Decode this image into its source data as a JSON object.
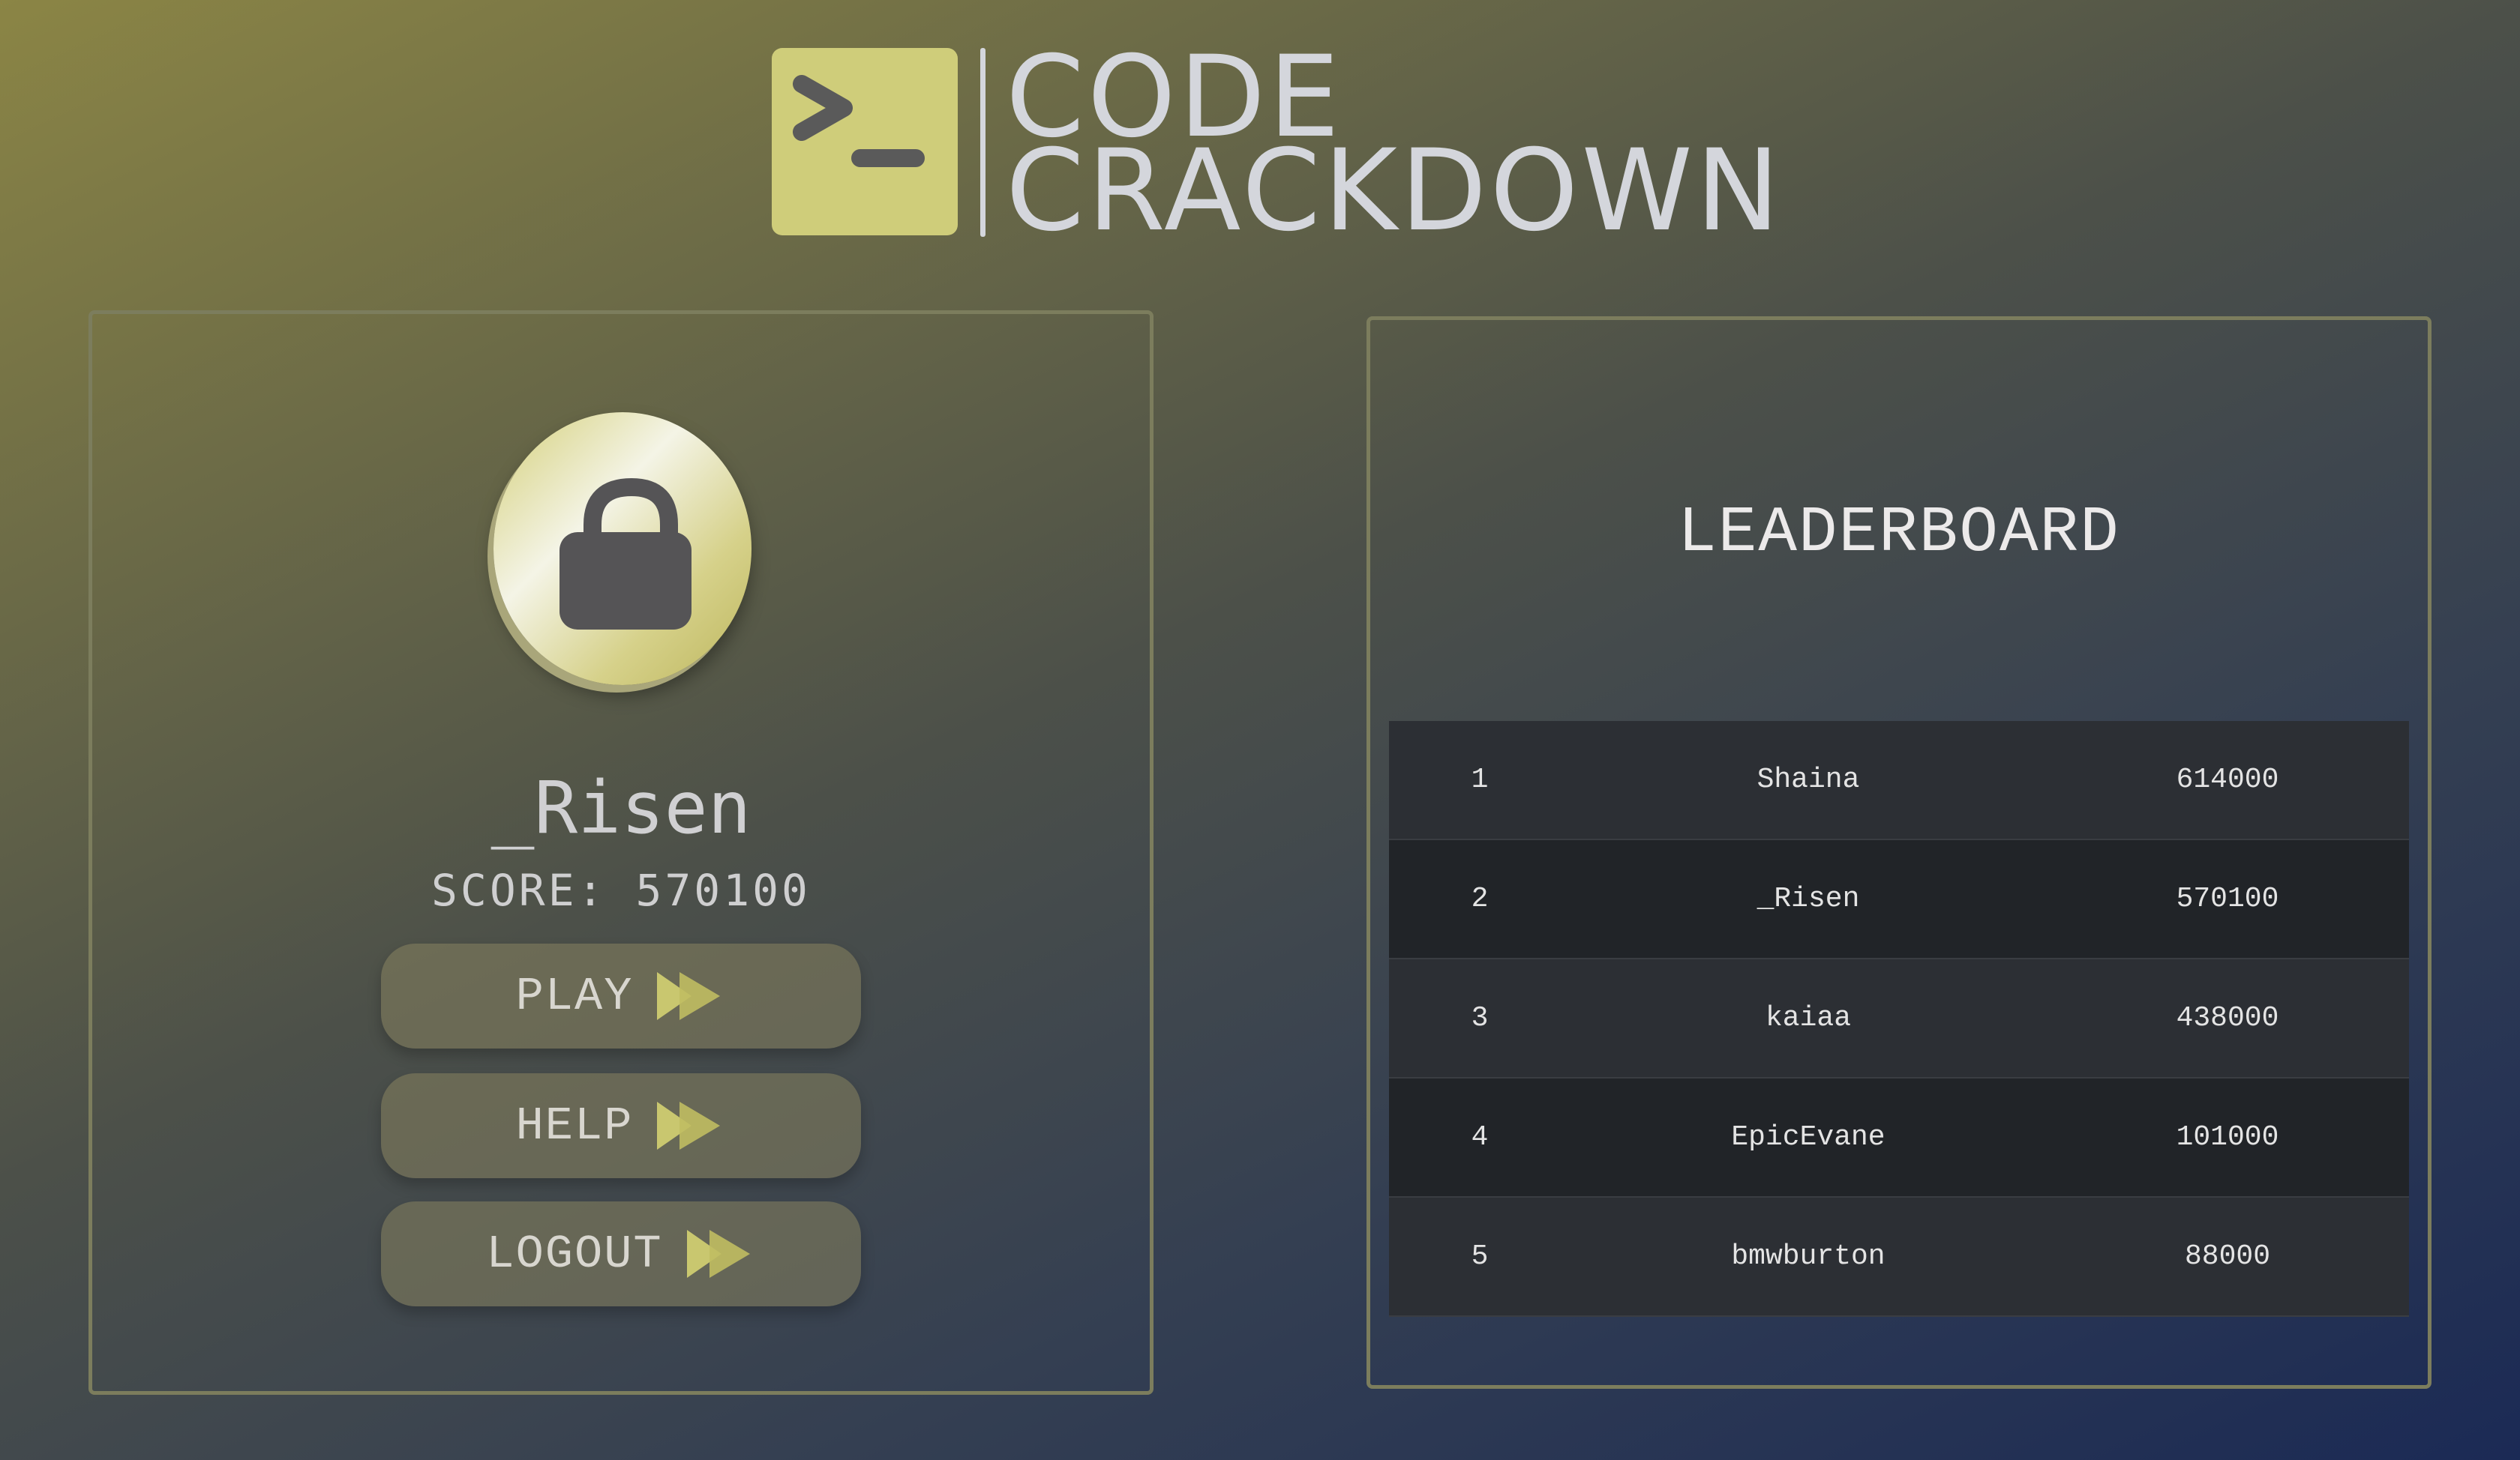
{
  "app": {
    "logo_line1": "CODE",
    "logo_line2": "CRACKDOWN",
    "logo_icon": "terminal-prompt-icon",
    "accent_color": "#cfcd7a"
  },
  "profile": {
    "avatar_icon": "unlocked-padlock-icon",
    "username": "_Risen",
    "score_label": "SCORE:",
    "score_value": "570100"
  },
  "menu": {
    "play_label": "PLAY",
    "help_label": "HELP",
    "logout_label": "LOGOUT",
    "arrow_icon": "fast-forward-icon"
  },
  "leaderboard": {
    "title": "LEADERBOARD",
    "rows": [
      {
        "rank": "1",
        "name": "Shaina",
        "score": "614000"
      },
      {
        "rank": "2",
        "name": "_Risen",
        "score": "570100"
      },
      {
        "rank": "3",
        "name": "kaiaa",
        "score": "438000"
      },
      {
        "rank": "4",
        "name": "EpicEvane",
        "score": "101000"
      },
      {
        "rank": "5",
        "name": "bmwburton",
        "score": "88000"
      }
    ]
  }
}
